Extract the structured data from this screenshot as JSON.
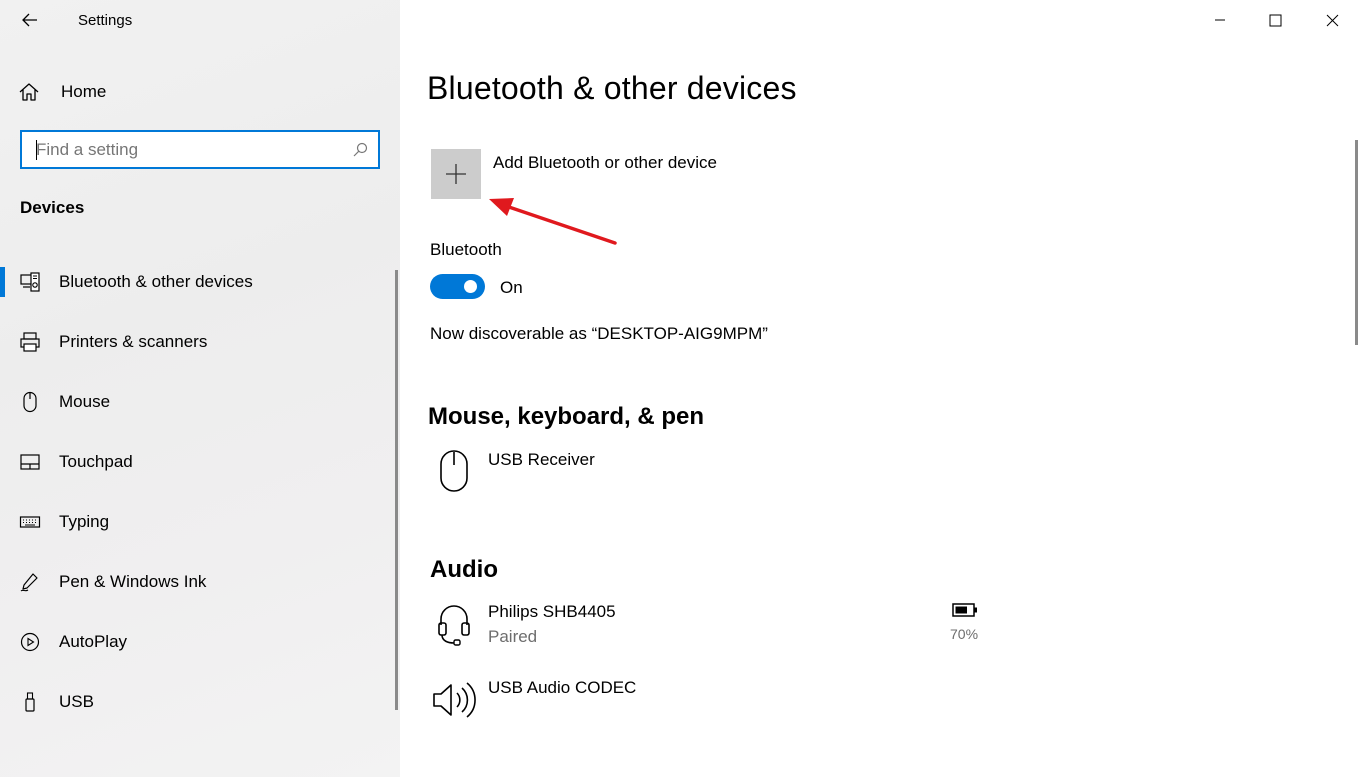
{
  "window": {
    "app_title": "Settings"
  },
  "sidebar": {
    "home_label": "Home",
    "search_placeholder": "Find a setting",
    "section_label": "Devices",
    "items": [
      {
        "label": "Bluetooth & other devices",
        "icon": "bluetooth-devices-icon",
        "active": true
      },
      {
        "label": "Printers & scanners",
        "icon": "printer-icon"
      },
      {
        "label": "Mouse",
        "icon": "mouse-icon"
      },
      {
        "label": "Touchpad",
        "icon": "touchpad-icon"
      },
      {
        "label": "Typing",
        "icon": "keyboard-icon"
      },
      {
        "label": "Pen & Windows Ink",
        "icon": "pen-icon"
      },
      {
        "label": "AutoPlay",
        "icon": "autoplay-icon"
      },
      {
        "label": "USB",
        "icon": "usb-icon"
      }
    ]
  },
  "main": {
    "title": "Bluetooth & other devices",
    "add_device_label": "Add Bluetooth or other device",
    "bluetooth": {
      "label": "Bluetooth",
      "state": "On",
      "enabled": true,
      "discoverable_text": "Now discoverable as “DESKTOP-AIG9MPM”"
    },
    "sections": {
      "mouse_keyboard_pen": {
        "heading": "Mouse, keyboard, & pen",
        "devices": [
          {
            "name": "USB Receiver",
            "icon": "mouse-icon"
          }
        ]
      },
      "audio": {
        "heading": "Audio",
        "devices": [
          {
            "name": "Philips SHB4405",
            "status": "Paired",
            "battery": "70%",
            "icon": "headset-icon"
          },
          {
            "name": "USB Audio CODEC",
            "icon": "speaker-icon"
          }
        ]
      }
    }
  },
  "colors": {
    "accent": "#0078d7",
    "annotation_arrow": "#e0191e"
  }
}
